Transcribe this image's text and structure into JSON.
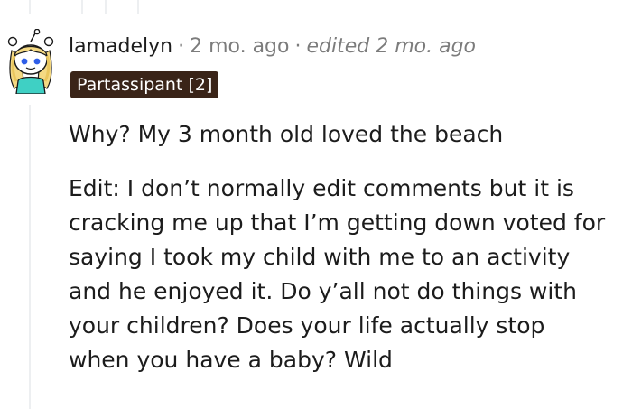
{
  "comment": {
    "username": "lamadelyn",
    "separator": "·",
    "posted_time": "2 mo. ago",
    "edited_label": "edited 2 mo. ago",
    "flair": "Partassipant [2]",
    "avatar_icon": "snoo-avatar-icon",
    "body": {
      "paragraph_1": "Why? My 3 month old loved the beach",
      "paragraph_2_lines": [
        "Edit: I don’t normally edit comments but it is",
        "cracking me up that I’m getting down voted for",
        "saying I took my child with me to an activity",
        "and he enjoyed it. Do y’all not do things with",
        "your children? Does your life actually stop",
        "when you have a baby? Wild"
      ]
    }
  },
  "colors": {
    "username": "#1c1c1c",
    "meta": "#7c7c7c",
    "flair_background": "#3a2418",
    "flair_text": "#ffffff",
    "thread_line": "#edeff1",
    "body_text": "#1c1c1c"
  }
}
